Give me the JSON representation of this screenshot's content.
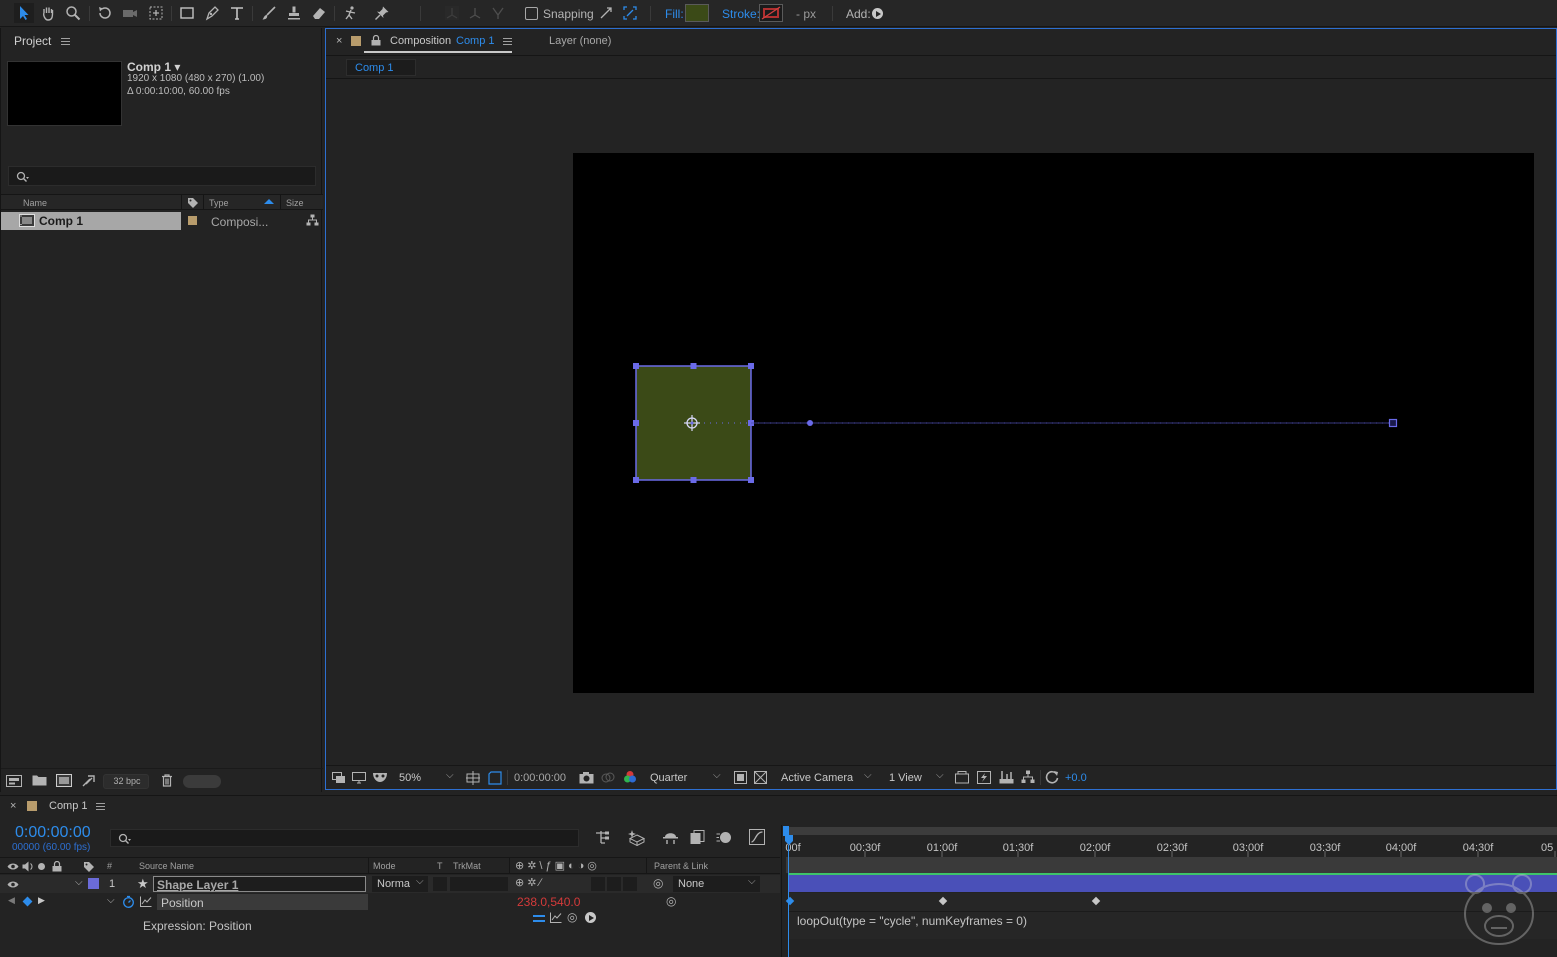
{
  "toolbar": {
    "snapping_label": "Snapping",
    "fill_label": "Fill:",
    "stroke_label": "Stroke:",
    "stroke_width": "- px",
    "add_label": "Add:",
    "fill_color": "#3b4a17"
  },
  "project": {
    "tab": "Project",
    "comp_name": "Comp 1 ▾",
    "comp_res": "1920 x 1080  (480 x 270) (1.00)",
    "comp_duration": "Δ 0:00:10:00, 60.00 fps",
    "columns": {
      "name": "Name",
      "type": "Type",
      "size": "Size"
    },
    "items": [
      {
        "name": "Comp 1",
        "type": "Composi..."
      }
    ],
    "bpc": "32 bpc"
  },
  "composition": {
    "tab_prefix": "Composition",
    "tab_name": "Comp 1",
    "layer_tab": "Layer (none)",
    "breadcrumb": "Comp 1",
    "zoom": "50%",
    "timecode": "0:00:00:00",
    "resolution": "Quarter",
    "camera": "Active Camera",
    "views": "1 View",
    "exposure": "+0.0"
  },
  "timeline": {
    "tab": "Comp 1",
    "current_time": "0:00:00:00",
    "frame_info": "00000 (60.00 fps)",
    "columns": {
      "source_name": "Source Name",
      "mode": "Mode",
      "t": "T",
      "trkmat": "TrkMat",
      "parent": "Parent & Link"
    },
    "layer": {
      "number": "1",
      "name": "Shape Layer 1",
      "mode": "Norma",
      "parent": "None"
    },
    "property": {
      "name": "Position",
      "value": "238.0,540.0"
    },
    "expression_label": "Expression: Position",
    "expression": "loopOut(type = \"cycle\", numKeyframes = 0)",
    "ruler": [
      "00f",
      "00:30f",
      "01:00f",
      "01:30f",
      "02:00f",
      "02:30f",
      "03:00f",
      "03:30f",
      "04:00f",
      "04:30f",
      "05"
    ]
  }
}
